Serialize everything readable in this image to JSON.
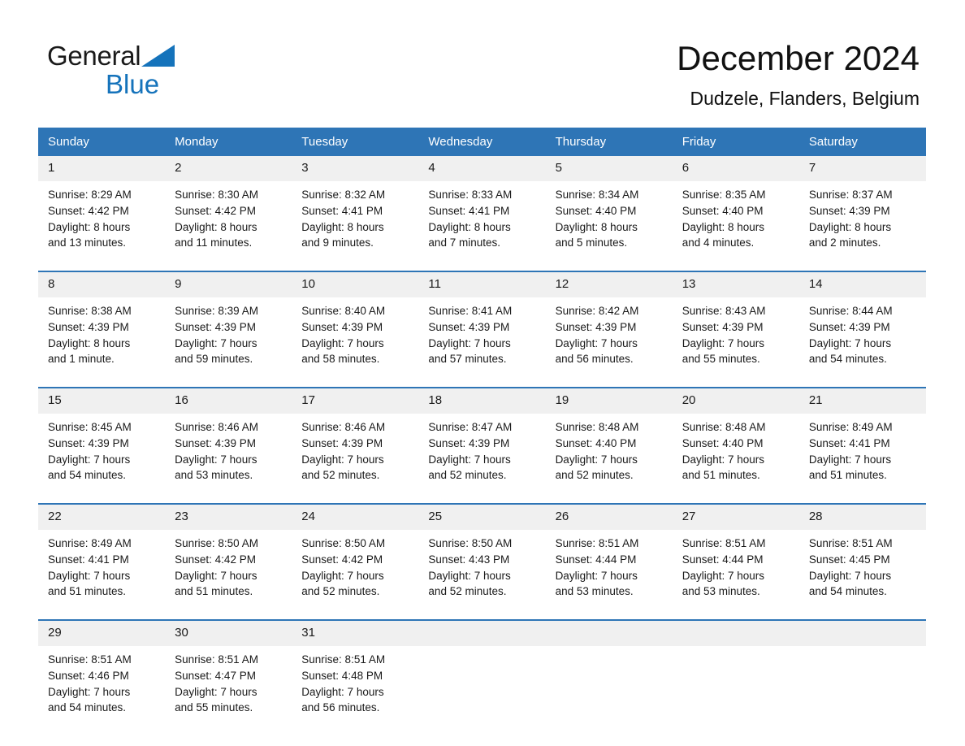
{
  "brand": {
    "word_one": "General",
    "word_two": "Blue",
    "triangle_icon": "triangle-logo-icon",
    "accent_color": "#1573bb"
  },
  "header": {
    "title": "December 2024",
    "subtitle": "Dudzele, Flanders, Belgium"
  },
  "theme": {
    "header_blue": "#2e75b6",
    "daynum_band": "#f0f0f0",
    "text": "#1a1a1a"
  },
  "weekdays": [
    "Sunday",
    "Monday",
    "Tuesday",
    "Wednesday",
    "Thursday",
    "Friday",
    "Saturday"
  ],
  "weeks": [
    [
      {
        "day": "1",
        "sunrise": "Sunrise: 8:29 AM",
        "sunset": "Sunset: 4:42 PM",
        "daylight1": "Daylight: 8 hours",
        "daylight2": "and 13 minutes."
      },
      {
        "day": "2",
        "sunrise": "Sunrise: 8:30 AM",
        "sunset": "Sunset: 4:42 PM",
        "daylight1": "Daylight: 8 hours",
        "daylight2": "and 11 minutes."
      },
      {
        "day": "3",
        "sunrise": "Sunrise: 8:32 AM",
        "sunset": "Sunset: 4:41 PM",
        "daylight1": "Daylight: 8 hours",
        "daylight2": "and 9 minutes."
      },
      {
        "day": "4",
        "sunrise": "Sunrise: 8:33 AM",
        "sunset": "Sunset: 4:41 PM",
        "daylight1": "Daylight: 8 hours",
        "daylight2": "and 7 minutes."
      },
      {
        "day": "5",
        "sunrise": "Sunrise: 8:34 AM",
        "sunset": "Sunset: 4:40 PM",
        "daylight1": "Daylight: 8 hours",
        "daylight2": "and 5 minutes."
      },
      {
        "day": "6",
        "sunrise": "Sunrise: 8:35 AM",
        "sunset": "Sunset: 4:40 PM",
        "daylight1": "Daylight: 8 hours",
        "daylight2": "and 4 minutes."
      },
      {
        "day": "7",
        "sunrise": "Sunrise: 8:37 AM",
        "sunset": "Sunset: 4:39 PM",
        "daylight1": "Daylight: 8 hours",
        "daylight2": "and 2 minutes."
      }
    ],
    [
      {
        "day": "8",
        "sunrise": "Sunrise: 8:38 AM",
        "sunset": "Sunset: 4:39 PM",
        "daylight1": "Daylight: 8 hours",
        "daylight2": "and 1 minute."
      },
      {
        "day": "9",
        "sunrise": "Sunrise: 8:39 AM",
        "sunset": "Sunset: 4:39 PM",
        "daylight1": "Daylight: 7 hours",
        "daylight2": "and 59 minutes."
      },
      {
        "day": "10",
        "sunrise": "Sunrise: 8:40 AM",
        "sunset": "Sunset: 4:39 PM",
        "daylight1": "Daylight: 7 hours",
        "daylight2": "and 58 minutes."
      },
      {
        "day": "11",
        "sunrise": "Sunrise: 8:41 AM",
        "sunset": "Sunset: 4:39 PM",
        "daylight1": "Daylight: 7 hours",
        "daylight2": "and 57 minutes."
      },
      {
        "day": "12",
        "sunrise": "Sunrise: 8:42 AM",
        "sunset": "Sunset: 4:39 PM",
        "daylight1": "Daylight: 7 hours",
        "daylight2": "and 56 minutes."
      },
      {
        "day": "13",
        "sunrise": "Sunrise: 8:43 AM",
        "sunset": "Sunset: 4:39 PM",
        "daylight1": "Daylight: 7 hours",
        "daylight2": "and 55 minutes."
      },
      {
        "day": "14",
        "sunrise": "Sunrise: 8:44 AM",
        "sunset": "Sunset: 4:39 PM",
        "daylight1": "Daylight: 7 hours",
        "daylight2": "and 54 minutes."
      }
    ],
    [
      {
        "day": "15",
        "sunrise": "Sunrise: 8:45 AM",
        "sunset": "Sunset: 4:39 PM",
        "daylight1": "Daylight: 7 hours",
        "daylight2": "and 54 minutes."
      },
      {
        "day": "16",
        "sunrise": "Sunrise: 8:46 AM",
        "sunset": "Sunset: 4:39 PM",
        "daylight1": "Daylight: 7 hours",
        "daylight2": "and 53 minutes."
      },
      {
        "day": "17",
        "sunrise": "Sunrise: 8:46 AM",
        "sunset": "Sunset: 4:39 PM",
        "daylight1": "Daylight: 7 hours",
        "daylight2": "and 52 minutes."
      },
      {
        "day": "18",
        "sunrise": "Sunrise: 8:47 AM",
        "sunset": "Sunset: 4:39 PM",
        "daylight1": "Daylight: 7 hours",
        "daylight2": "and 52 minutes."
      },
      {
        "day": "19",
        "sunrise": "Sunrise: 8:48 AM",
        "sunset": "Sunset: 4:40 PM",
        "daylight1": "Daylight: 7 hours",
        "daylight2": "and 52 minutes."
      },
      {
        "day": "20",
        "sunrise": "Sunrise: 8:48 AM",
        "sunset": "Sunset: 4:40 PM",
        "daylight1": "Daylight: 7 hours",
        "daylight2": "and 51 minutes."
      },
      {
        "day": "21",
        "sunrise": "Sunrise: 8:49 AM",
        "sunset": "Sunset: 4:41 PM",
        "daylight1": "Daylight: 7 hours",
        "daylight2": "and 51 minutes."
      }
    ],
    [
      {
        "day": "22",
        "sunrise": "Sunrise: 8:49 AM",
        "sunset": "Sunset: 4:41 PM",
        "daylight1": "Daylight: 7 hours",
        "daylight2": "and 51 minutes."
      },
      {
        "day": "23",
        "sunrise": "Sunrise: 8:50 AM",
        "sunset": "Sunset: 4:42 PM",
        "daylight1": "Daylight: 7 hours",
        "daylight2": "and 51 minutes."
      },
      {
        "day": "24",
        "sunrise": "Sunrise: 8:50 AM",
        "sunset": "Sunset: 4:42 PM",
        "daylight1": "Daylight: 7 hours",
        "daylight2": "and 52 minutes."
      },
      {
        "day": "25",
        "sunrise": "Sunrise: 8:50 AM",
        "sunset": "Sunset: 4:43 PM",
        "daylight1": "Daylight: 7 hours",
        "daylight2": "and 52 minutes."
      },
      {
        "day": "26",
        "sunrise": "Sunrise: 8:51 AM",
        "sunset": "Sunset: 4:44 PM",
        "daylight1": "Daylight: 7 hours",
        "daylight2": "and 53 minutes."
      },
      {
        "day": "27",
        "sunrise": "Sunrise: 8:51 AM",
        "sunset": "Sunset: 4:44 PM",
        "daylight1": "Daylight: 7 hours",
        "daylight2": "and 53 minutes."
      },
      {
        "day": "28",
        "sunrise": "Sunrise: 8:51 AM",
        "sunset": "Sunset: 4:45 PM",
        "daylight1": "Daylight: 7 hours",
        "daylight2": "and 54 minutes."
      }
    ],
    [
      {
        "day": "29",
        "sunrise": "Sunrise: 8:51 AM",
        "sunset": "Sunset: 4:46 PM",
        "daylight1": "Daylight: 7 hours",
        "daylight2": "and 54 minutes."
      },
      {
        "day": "30",
        "sunrise": "Sunrise: 8:51 AM",
        "sunset": "Sunset: 4:47 PM",
        "daylight1": "Daylight: 7 hours",
        "daylight2": "and 55 minutes."
      },
      {
        "day": "31",
        "sunrise": "Sunrise: 8:51 AM",
        "sunset": "Sunset: 4:48 PM",
        "daylight1": "Daylight: 7 hours",
        "daylight2": "and 56 minutes."
      },
      {
        "day": "",
        "sunrise": "",
        "sunset": "",
        "daylight1": "",
        "daylight2": ""
      },
      {
        "day": "",
        "sunrise": "",
        "sunset": "",
        "daylight1": "",
        "daylight2": ""
      },
      {
        "day": "",
        "sunrise": "",
        "sunset": "",
        "daylight1": "",
        "daylight2": ""
      },
      {
        "day": "",
        "sunrise": "",
        "sunset": "",
        "daylight1": "",
        "daylight2": ""
      }
    ]
  ]
}
